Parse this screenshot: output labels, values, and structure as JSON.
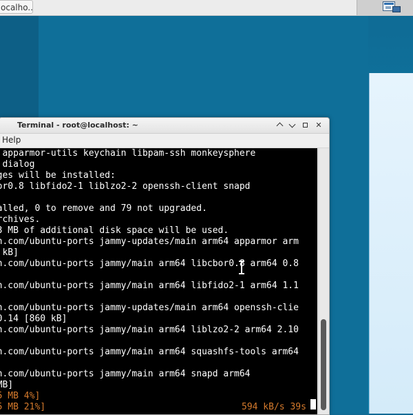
{
  "topbar": {
    "task_button_label": "ocalho..."
  },
  "terminal": {
    "title": "Terminal - root@localhost: ~",
    "menu_help": "Help",
    "lines": [
      "   apparmor-utils keychain libpam-ssh monkeysphere",
      "   dialog",
      "  ges will be installed:",
      "  or0.8 libfido2-1 liblzo2-2 openssh-client snapd",
      "",
      "  alled, 0 to remove and 79 not upgraded.",
      "  rchives.",
      "  3 MB of additional disk space will be used.",
      "  n.com/ubuntu-ports jammy-updates/main arm64 apparmor arm",
      "   kB]",
      "  n.com/ubuntu-ports jammy/main arm64 libcbor0.8 arm64 0.8",
      "",
      "  n.com/ubuntu-ports jammy/main arm64 libfido2-1 arm64 1.1",
      "",
      "  n.com/ubuntu-ports jammy-updates/main arm64 openssh-clie",
      "  0.14 [860 kB]",
      "  n.com/ubuntu-ports jammy/main arm64 liblzo2-2 arm64 2.10",
      "",
      "  n.com/ubuntu-ports jammy/main arm64 squashfs-tools arm64",
      "",
      "  n.com/ubuntu-ports jammy/main arm64 snapd arm64",
      "  MB]",
      "  5 MB 4%]",
      "  5 MB 21%]"
    ],
    "progress_rate": "594 kB/s 39s"
  },
  "colors": {
    "progress_text": "#d57a2c",
    "terminal_bg": "#000000",
    "terminal_fg": "#ffffff"
  }
}
